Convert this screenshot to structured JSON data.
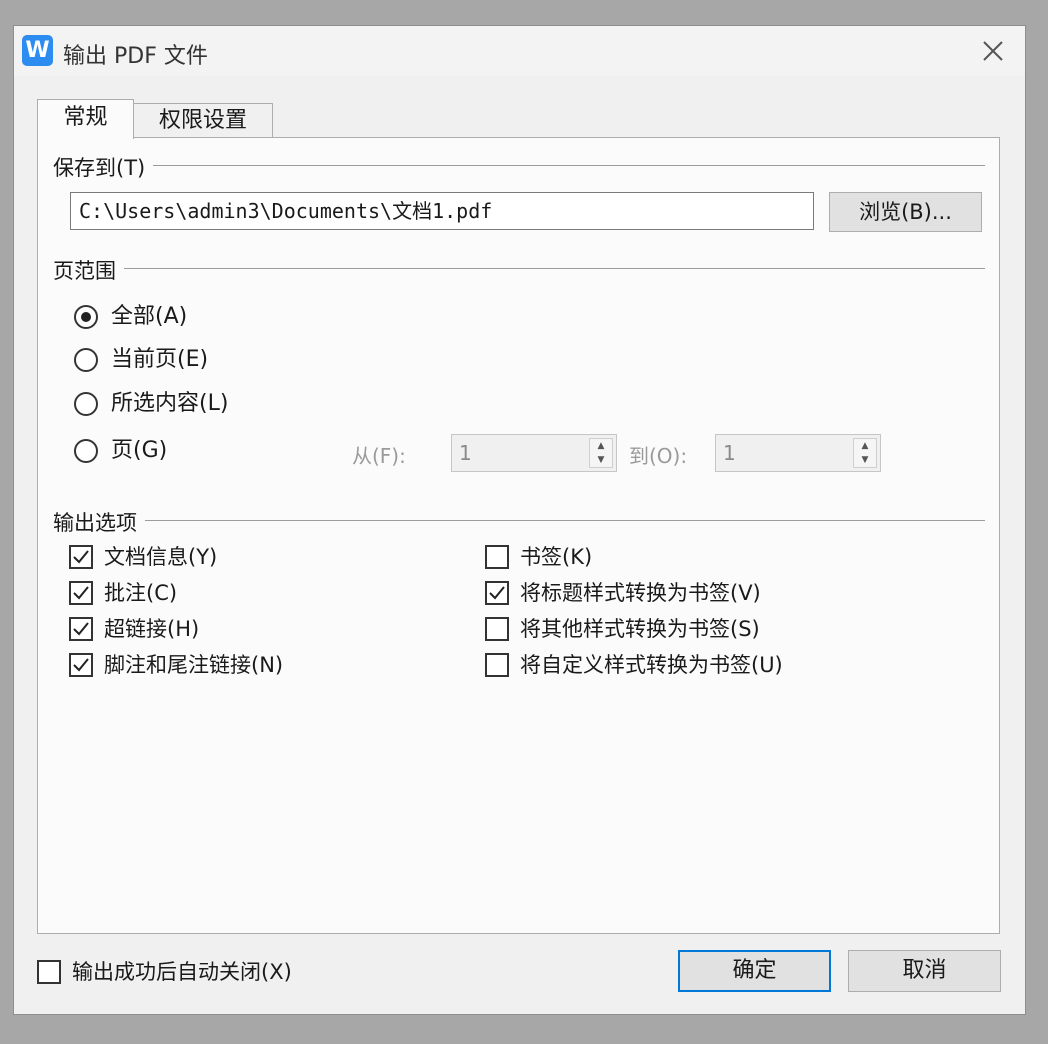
{
  "window": {
    "title": "输出 PDF 文件",
    "app_icon_letter": "W"
  },
  "tabs": [
    {
      "label": "常规",
      "active": true
    },
    {
      "label": "权限设置",
      "active": false
    }
  ],
  "save_to": {
    "group_label": "保存到(T)",
    "path_value": "C:\\Users\\admin3\\Documents\\文档1.pdf",
    "browse_label": "浏览(B)..."
  },
  "page_range": {
    "group_label": "页范围",
    "options": [
      {
        "label": "全部(A)",
        "selected": true
      },
      {
        "label": "当前页(E)",
        "selected": false
      },
      {
        "label": "所选内容(L)",
        "selected": false
      },
      {
        "label": "页(G)",
        "selected": false
      }
    ],
    "from_label": "从(F):",
    "from_value": "1",
    "to_label": "到(O):",
    "to_value": "1"
  },
  "output_options": {
    "group_label": "输出选项",
    "left": [
      {
        "label": "文档信息(Y)",
        "checked": true
      },
      {
        "label": "批注(C)",
        "checked": true
      },
      {
        "label": "超链接(H)",
        "checked": true
      },
      {
        "label": "脚注和尾注链接(N)",
        "checked": true
      }
    ],
    "right": [
      {
        "label": "书签(K)",
        "checked": false
      },
      {
        "label": "将标题样式转换为书签(V)",
        "checked": true
      },
      {
        "label": "将其他样式转换为书签(S)",
        "checked": false
      },
      {
        "label": "将自定义样式转换为书签(U)",
        "checked": false
      }
    ]
  },
  "footer": {
    "auto_close_label": "输出成功后自动关闭(X)",
    "auto_close_checked": false,
    "ok_label": "确定",
    "cancel_label": "取消"
  }
}
